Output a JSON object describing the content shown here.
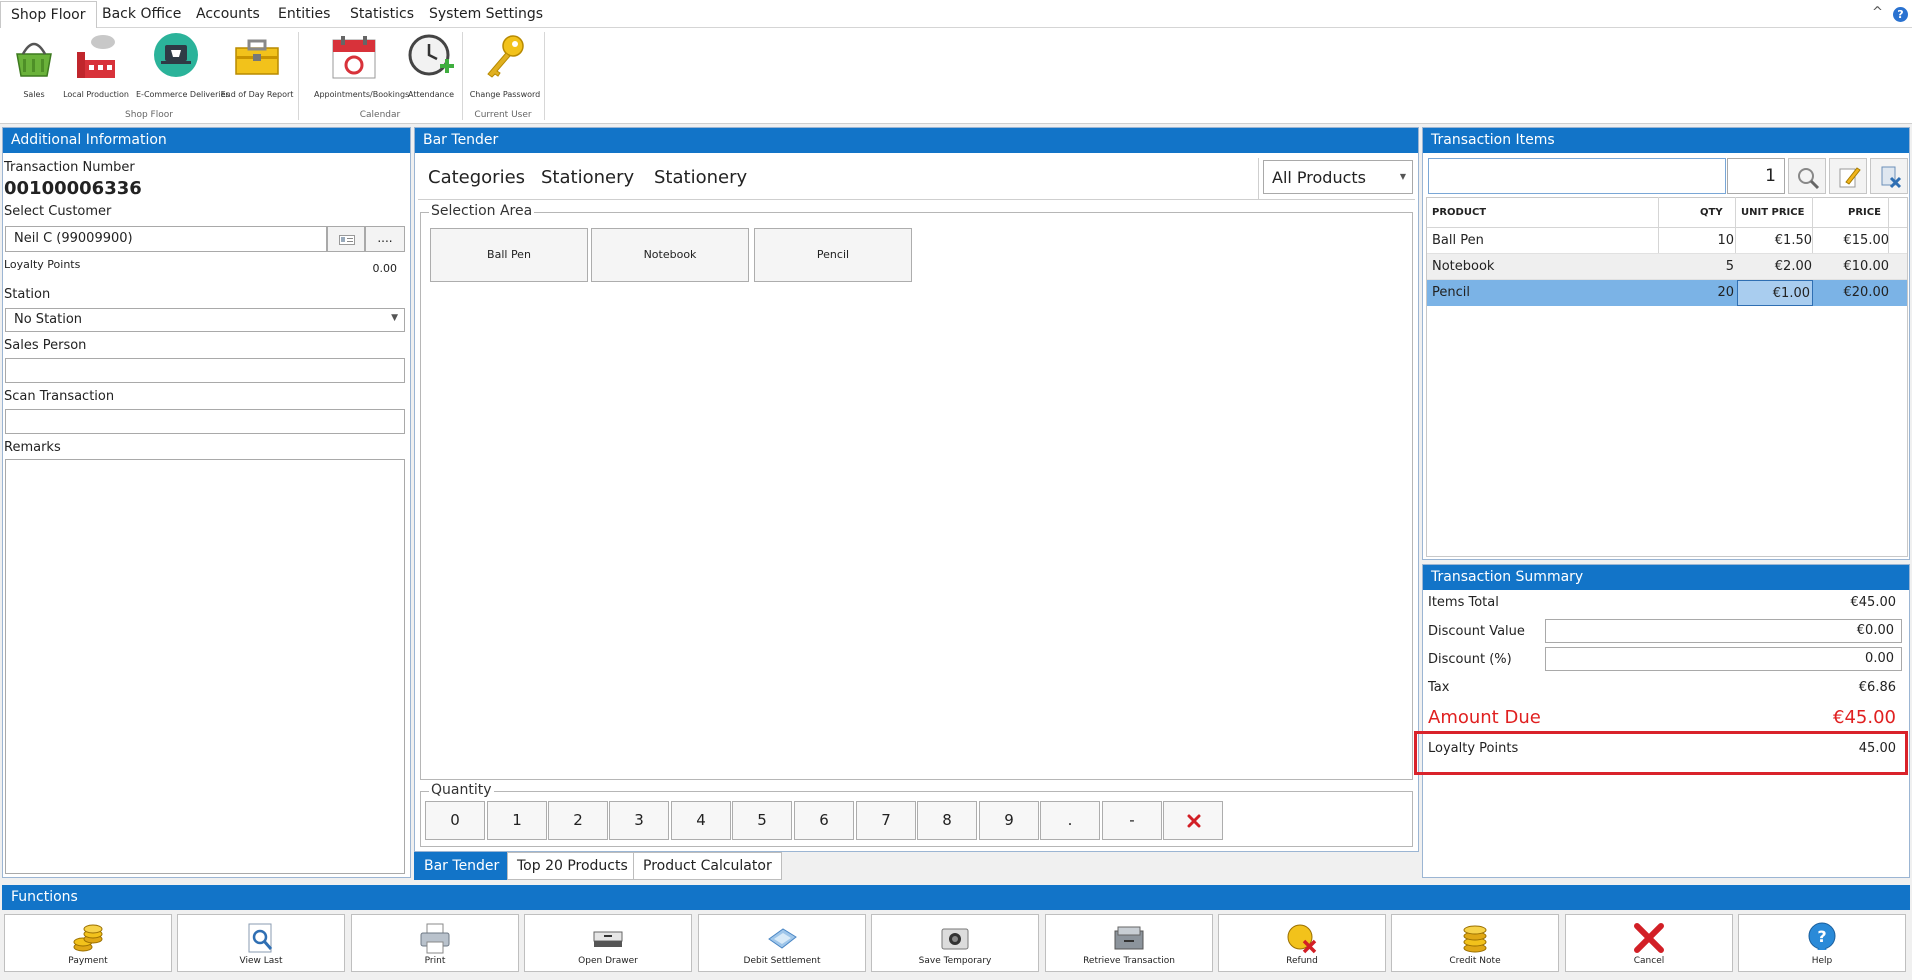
{
  "ribbon": {
    "tabs": [
      "Shop Floor",
      "Back Office",
      "Accounts",
      "Entities",
      "Statistics",
      "System Settings"
    ],
    "buttons": [
      {
        "label": "Sales",
        "icon": "basket-icon"
      },
      {
        "label": "Local Production",
        "icon": "factory-icon"
      },
      {
        "label": "E-Commerce Deliveries",
        "icon": "ecommerce-icon"
      },
      {
        "label": "End of Day Report",
        "icon": "toolbox-icon"
      },
      {
        "label": "Appointments/Bookings",
        "icon": "calendar-icon"
      },
      {
        "label": "Attendance",
        "icon": "clock-icon"
      },
      {
        "label": "Change Password",
        "icon": "key-icon"
      }
    ],
    "groups": [
      "Shop Floor",
      "Calendar",
      "Current User"
    ],
    "collapse_glyph": "^",
    "help_glyph": "?"
  },
  "additional_info": {
    "title": "Additional Information",
    "transaction_number_label": "Transaction Number",
    "transaction_number": "00100006336",
    "select_customer_label": "Select Customer",
    "customer_value": "Neil C (99009900)",
    "more_button": "....",
    "loyalty_label": "Loyalty Points",
    "loyalty_value": "0.00",
    "station_label": "Station",
    "station_value": "No Station",
    "sales_person_label": "Sales Person",
    "scan_transaction_label": "Scan Transaction",
    "remarks_label": "Remarks"
  },
  "bar_tender": {
    "title": "Bar Tender",
    "breadcrumbs": [
      "Categories",
      "Stationery",
      "Stationery"
    ],
    "filter_value": "All Products",
    "selection_area_label": "Selection Area",
    "products": [
      "Ball Pen",
      "Notebook",
      "Pencil"
    ],
    "quantity_label": "Quantity",
    "keypad": [
      "0",
      "1",
      "2",
      "3",
      "4",
      "5",
      "6",
      "7",
      "8",
      "9",
      ".",
      "-"
    ],
    "bottom_tabs": [
      "Bar Tender",
      "Top 20 Products",
      "Product Calculator"
    ]
  },
  "transaction_items": {
    "title": "Transaction Items",
    "search_qty": "1",
    "headers": [
      "PRODUCT",
      "QTY",
      "UNIT PRICE",
      "PRICE"
    ],
    "rows": [
      {
        "product": "Ball Pen",
        "qty": "10",
        "unit_price": "€1.50",
        "price": "€15.00"
      },
      {
        "product": "Notebook",
        "qty": "5",
        "unit_price": "€2.00",
        "price": "€10.00"
      },
      {
        "product": "Pencil",
        "qty": "20",
        "unit_price": "€1.00",
        "price": "€20.00"
      }
    ]
  },
  "summary": {
    "title": "Transaction Summary",
    "items_total_label": "Items Total",
    "items_total": "€45.00",
    "discount_value_label": "Discount Value",
    "discount_value": "€0.00",
    "discount_pct_label": "Discount (%)",
    "discount_pct": "0.00",
    "tax_label": "Tax",
    "tax": "€6.86",
    "amount_due_label": "Amount Due",
    "amount_due": "€45.00",
    "loyalty_label": "Loyalty Points",
    "loyalty_value": "45.00"
  },
  "functions": {
    "title": "Functions",
    "buttons": [
      {
        "label": "Payment",
        "icon": "coins-icon"
      },
      {
        "label": "View Last",
        "icon": "view-last-icon"
      },
      {
        "label": "Print",
        "icon": "printer-icon"
      },
      {
        "label": "Open Drawer",
        "icon": "drawer-icon"
      },
      {
        "label": "Debit Settlement",
        "icon": "debit-icon"
      },
      {
        "label": "Save Temporary",
        "icon": "save-temporary-icon"
      },
      {
        "label": "Retrieve Transaction",
        "icon": "retrieve-icon"
      },
      {
        "label": "Refund",
        "icon": "refund-icon"
      },
      {
        "label": "Credit Note",
        "icon": "credit-note-icon"
      },
      {
        "label": "Cancel",
        "icon": "cancel-icon"
      },
      {
        "label": "Help",
        "icon": "help-icon"
      }
    ]
  },
  "colors": {
    "header_blue": "#1274c8",
    "selected_row": "#7bb3e6",
    "amount_due_red": "#e02020",
    "highlight_border": "#d9222a"
  }
}
